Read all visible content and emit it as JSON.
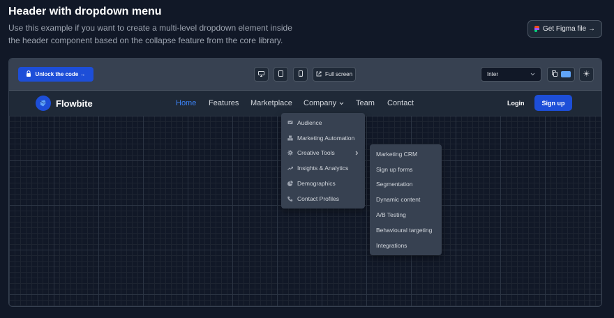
{
  "page": {
    "title": "Header with dropdown menu",
    "description": "Use this example if you want to create a multi-level dropdown element inside the header component based on the collapse feature from the core library.",
    "figma_button": "Get Figma file →"
  },
  "toolbar": {
    "unlock_label": "Unlock the code →",
    "fullscreen_label": "Full screen",
    "font_value": "Inter"
  },
  "app": {
    "brand": "Flowbite",
    "nav": [
      "Home",
      "Features",
      "Marketplace",
      "Company",
      "Team",
      "Contact"
    ],
    "login": "Login",
    "signup": "Sign up"
  },
  "company_menu": [
    {
      "label": "Audience",
      "icon": "audience-icon"
    },
    {
      "label": "Marketing Automation",
      "icon": "cubes-icon"
    },
    {
      "label": "Creative Tools",
      "icon": "gear-icon"
    },
    {
      "label": "Insights & Analytics",
      "icon": "trend-icon"
    },
    {
      "label": "Demographics",
      "icon": "pie-icon"
    },
    {
      "label": "Contact Profiles",
      "icon": "phone-icon"
    }
  ],
  "creative_submenu": [
    "Marketing CRM",
    "Sign up forms",
    "Segmentation",
    "Dynamic content",
    "A/B Testing",
    "Behavioural targeting",
    "Integrations"
  ],
  "colors": {
    "background": "#111827",
    "accent": "#1d4ed8",
    "active_link": "#3b82f6"
  }
}
